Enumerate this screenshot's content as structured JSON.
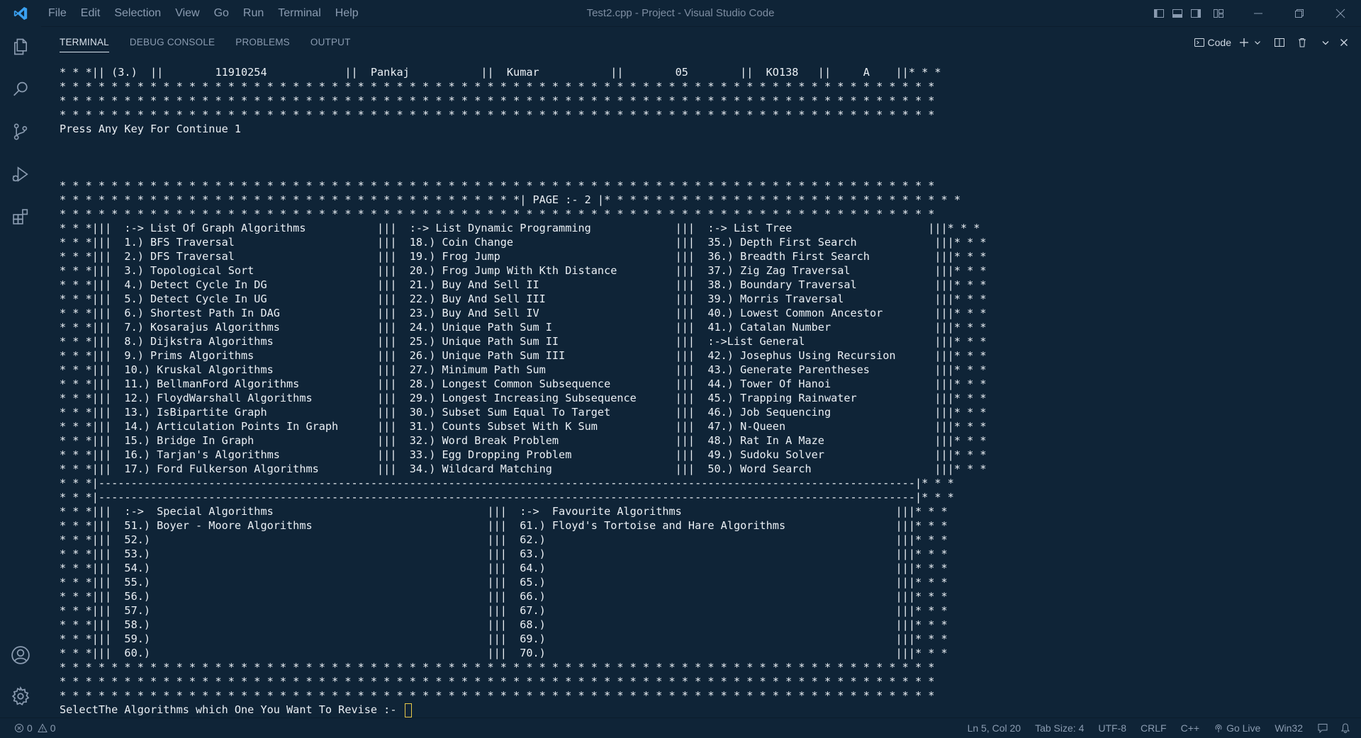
{
  "window": {
    "title": "Test2.cpp - Project - Visual Studio Code",
    "menu": [
      "File",
      "Edit",
      "Selection",
      "View",
      "Go",
      "Run",
      "Terminal",
      "Help"
    ]
  },
  "panel": {
    "tabs": [
      "TERMINAL",
      "DEBUG CONSOLE",
      "PROBLEMS",
      "OUTPUT"
    ],
    "active_tab": "TERMINAL",
    "terminal_name": "Code"
  },
  "terminal": {
    "lines": [
      "* * *|| (3.)  ||        11910254            ||  Pankaj           ||  Kumar           ||        05        ||  KO138   ||     A    ||* * *",
      "* * * * * * * * * * * * * * * * * * * * * * * * * * * * * * * * * * * * * * * * * * * * * * * * * * * * * * * * * * * * * * * * * * * *",
      "* * * * * * * * * * * * * * * * * * * * * * * * * * * * * * * * * * * * * * * * * * * * * * * * * * * * * * * * * * * * * * * * * * * *",
      "* * * * * * * * * * * * * * * * * * * * * * * * * * * * * * * * * * * * * * * * * * * * * * * * * * * * * * * * * * * * * * * * * * * *",
      "Press Any Key For Continue 1",
      "",
      "",
      "",
      "* * * * * * * * * * * * * * * * * * * * * * * * * * * * * * * * * * * * * * * * * * * * * * * * * * * * * * * * * * * * * * * * * * * *",
      "* * * * * * * * * * * * * * * * * * * * * * * * * * * * * * * * * * * *| PAGE :- 2 |* * * * * * * * * * * * * * * * * * * * * * * * * * * *",
      "* * * * * * * * * * * * * * * * * * * * * * * * * * * * * * * * * * * * * * * * * * * * * * * * * * * * * * * * * * * * * * * * * * * *",
      "* * *|||  :-> List Of Graph Algorithms           |||  :-> List Dynamic Programming             |||  :-> List Tree                     |||* * *",
      "* * *|||  1.) BFS Traversal                      |||  18.) Coin Change                         |||  35.) Depth First Search            |||* * *",
      "* * *|||  2.) DFS Traversal                      |||  19.) Frog Jump                           |||  36.) Breadth First Search          |||* * *",
      "* * *|||  3.) Topological Sort                   |||  20.) Frog Jump With Kth Distance         |||  37.) Zig Zag Traversal             |||* * *",
      "* * *|||  4.) Detect Cycle In DG                 |||  21.) Buy And Sell II                     |||  38.) Boundary Traversal            |||* * *",
      "* * *|||  5.) Detect Cycle In UG                 |||  22.) Buy And Sell III                    |||  39.) Morris Traversal              |||* * *",
      "* * *|||  6.) Shortest Path In DAG               |||  23.) Buy And Sell IV                     |||  40.) Lowest Common Ancestor        |||* * *",
      "* * *|||  7.) Kosarajus Algorithms               |||  24.) Unique Path Sum I                   |||  41.) Catalan Number                |||* * *",
      "* * *|||  8.) Dijkstra Algorithms                |||  25.) Unique Path Sum II                  |||  :->List General                    |||* * *",
      "* * *|||  9.) Prims Algorithms                   |||  26.) Unique Path Sum III                 |||  42.) Josephus Using Recursion      |||* * *",
      "* * *|||  10.) Kruskal Algorithms                |||  27.) Minimum Path Sum                    |||  43.) Generate Parentheses          |||* * *",
      "* * *|||  11.) BellmanFord Algorithms            |||  28.) Longest Common Subsequence          |||  44.) Tower Of Hanoi                |||* * *",
      "* * *|||  12.) FloydWarshall Algorithms          |||  29.) Longest Increasing Subsequence      |||  45.) Trapping Rainwater            |||* * *",
      "* * *|||  13.) IsBipartite Graph                 |||  30.) Subset Sum Equal To Target          |||  46.) Job Sequencing                |||* * *",
      "* * *|||  14.) Articulation Points In Graph      |||  31.) Counts Subset With K Sum            |||  47.) N-Queen                       |||* * *",
      "* * *|||  15.) Bridge In Graph                   |||  32.) Word Break Problem                  |||  48.) Rat In A Maze                 |||* * *",
      "* * *|||  16.) Tarjan's Algorithms               |||  33.) Egg Dropping Problem                |||  49.) Sudoku Solver                 |||* * *",
      "* * *|||  17.) Ford Fulkerson Algorithms         |||  34.) Wildcard Matching                   |||  50.) Word Search                   |||* * *",
      "* * *|------------------------------------------------------------------------------------------------------------------------------|* * *",
      "* * *|------------------------------------------------------------------------------------------------------------------------------|* * *",
      "* * *|||  :->  Special Algorithms                                 |||  :->  Favourite Algorithms                                 |||* * *",
      "* * *|||  51.) Boyer - Moore Algorithms                           |||  61.) Floyd's Tortoise and Hare Algorithms                 |||* * *",
      "* * *|||  52.)                                                    |||  62.)                                                      |||* * *",
      "* * *|||  53.)                                                    |||  63.)                                                      |||* * *",
      "* * *|||  54.)                                                    |||  64.)                                                      |||* * *",
      "* * *|||  55.)                                                    |||  65.)                                                      |||* * *",
      "* * *|||  56.)                                                    |||  66.)                                                      |||* * *",
      "* * *|||  57.)                                                    |||  67.)                                                      |||* * *",
      "* * *|||  58.)                                                    |||  68.)                                                      |||* * *",
      "* * *|||  59.)                                                    |||  69.)                                                      |||* * *",
      "* * *|||  60.)                                                    |||  70.)                                                      |||* * *",
      "* * * * * * * * * * * * * * * * * * * * * * * * * * * * * * * * * * * * * * * * * * * * * * * * * * * * * * * * * * * * * * * * * * * *",
      "* * * * * * * * * * * * * * * * * * * * * * * * * * * * * * * * * * * * * * * * * * * * * * * * * * * * * * * * * * * * * * * * * * * *",
      "* * * * * * * * * * * * * * * * * * * * * * * * * * * * * * * * * * * * * * * * * * * * * * * * * * * * * * * * * * * * * * * * * * * *"
    ],
    "prompt": "SelectThe Algorithms which One You Want To Revise :- "
  },
  "statusbar": {
    "errors": "0",
    "warnings": "0",
    "position": "Ln 5, Col 20",
    "tab_size": "Tab Size: 4",
    "encoding": "UTF-8",
    "line_ending": "CRLF",
    "language": "C++",
    "go_live": "Go Live",
    "platform": "Win32"
  },
  "colors": {
    "background": "#0f2437",
    "text": "#ebf0f5",
    "cursor": "#e8c94a",
    "vscode_blue": "#3aa0f0"
  }
}
